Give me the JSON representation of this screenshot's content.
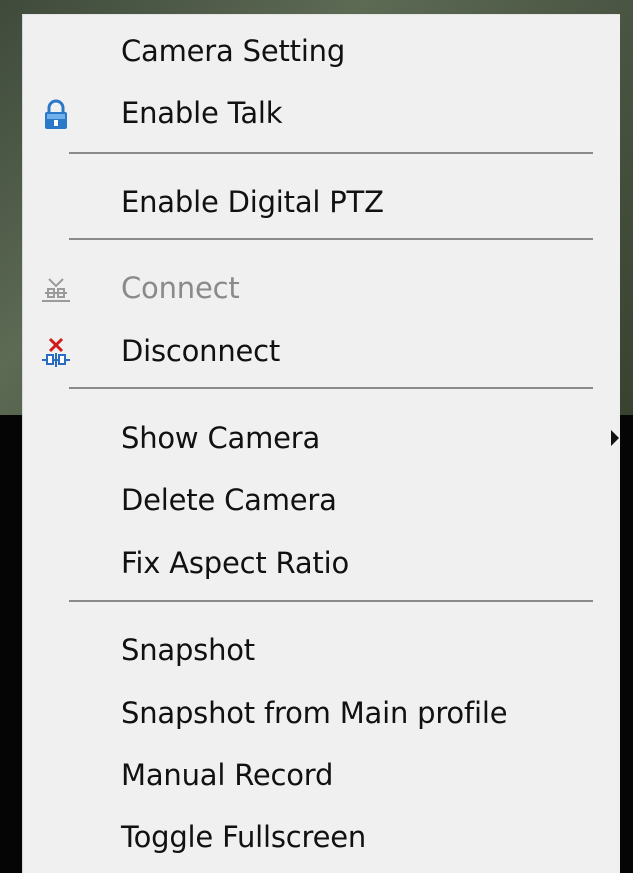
{
  "menu": {
    "items": [
      {
        "label": "Camera Setting",
        "icon": null,
        "enabled": true
      },
      {
        "label": "Enable Talk",
        "icon": "lock-icon",
        "enabled": true
      },
      {
        "label": "Enable Digital PTZ",
        "icon": null,
        "enabled": true
      },
      {
        "label": "Connect",
        "icon": "connect-icon",
        "enabled": false
      },
      {
        "label": "Disconnect",
        "icon": "disconnect-icon",
        "enabled": true
      },
      {
        "label": "Show Camera",
        "icon": null,
        "enabled": true,
        "submenu": true
      },
      {
        "label": "Delete Camera",
        "icon": null,
        "enabled": true
      },
      {
        "label": "Fix Aspect Ratio",
        "icon": null,
        "enabled": true
      },
      {
        "label": "Snapshot",
        "icon": null,
        "enabled": true
      },
      {
        "label": "Snapshot from Main profile",
        "icon": null,
        "enabled": true
      },
      {
        "label": "Manual Record",
        "icon": null,
        "enabled": true
      },
      {
        "label": "Toggle Fullscreen",
        "icon": null,
        "enabled": true
      }
    ]
  },
  "colors": {
    "menu_background": "#f0f0f0",
    "text": "#111111",
    "disabled_text": "#8a8a8a",
    "separator": "#8a8a8a",
    "lock_icon_blue": "#2a78c8",
    "disconnect_red": "#d11a1a"
  }
}
